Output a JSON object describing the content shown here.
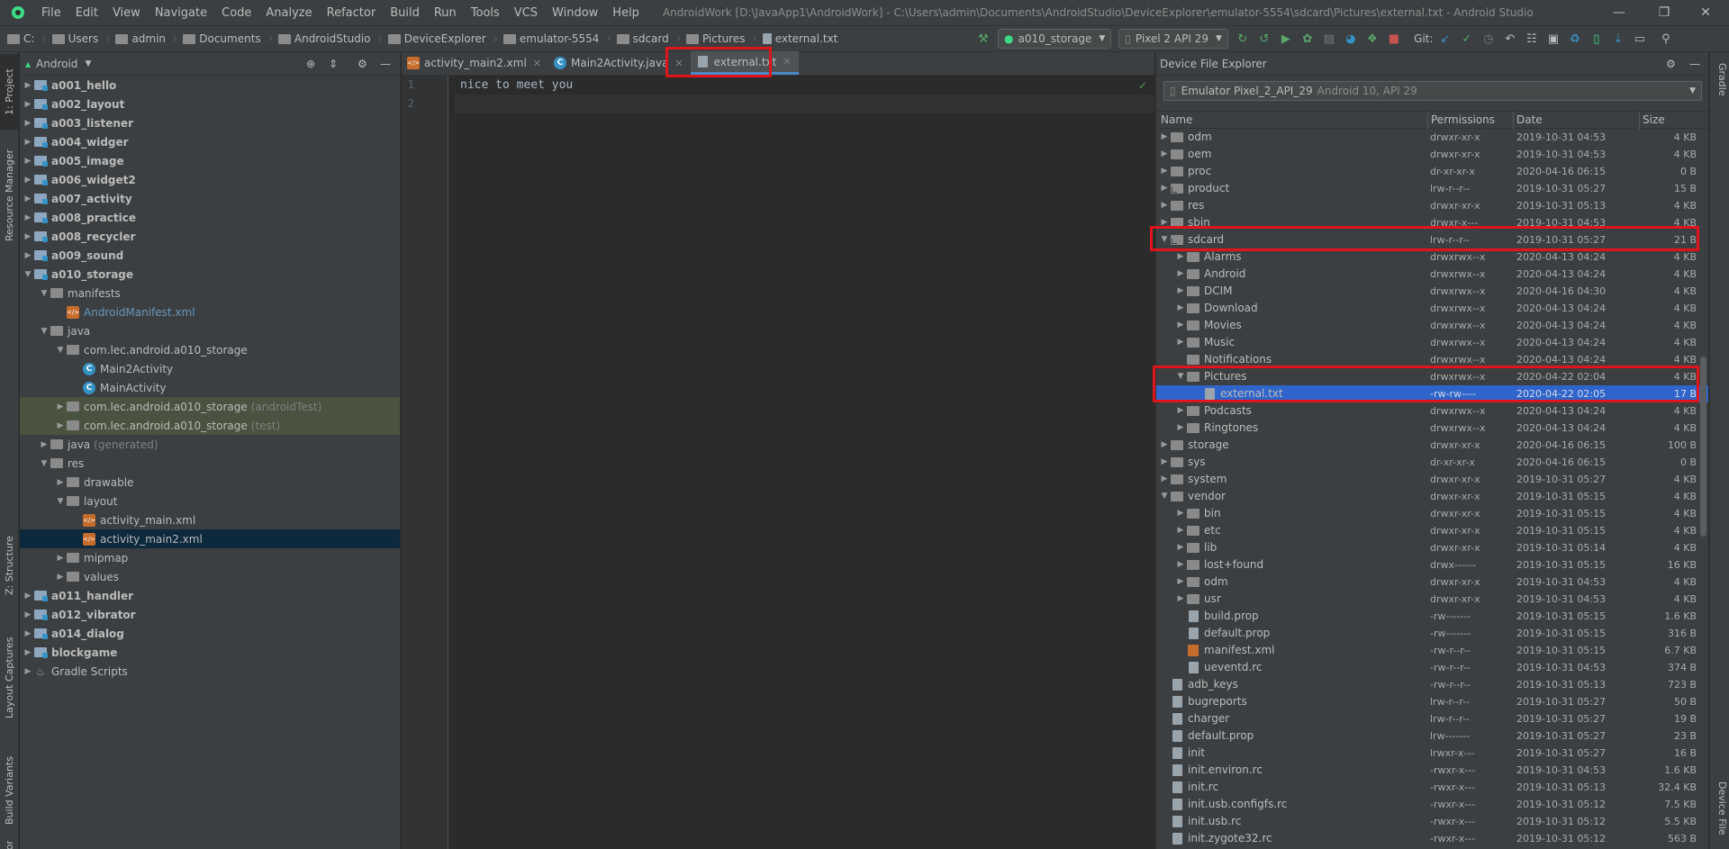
{
  "menubar": {
    "items": [
      "File",
      "Edit",
      "View",
      "Navigate",
      "Code",
      "Analyze",
      "Refactor",
      "Build",
      "Run",
      "Tools",
      "VCS",
      "Window",
      "Help"
    ],
    "window_title": "AndroidWork [D:\\JavaApp1\\AndroidWork] - C:\\Users\\admin\\Documents\\AndroidStudio\\DeviceExplorer\\emulator-5554\\sdcard\\Pictures\\external.txt - Android Studio"
  },
  "breadcrumb": [
    "C:",
    "Users",
    "admin",
    "Documents",
    "AndroidStudio",
    "DeviceExplorer",
    "emulator-5554",
    "sdcard",
    "Pictures",
    "external.txt"
  ],
  "toolbar": {
    "run_config": "a010_storage",
    "device": "Pixel 2 API 29",
    "git_label": "Git:"
  },
  "left_strip": {
    "tabs": [
      "1: Project",
      "Resource Manager",
      "Z: Structure",
      "Layout Captures",
      "Build Variants",
      "Favorites"
    ]
  },
  "right_strip": {
    "tabs": [
      "Gradle",
      "Device File"
    ]
  },
  "project": {
    "view_mode": "Android",
    "tree": [
      {
        "label": "a001_hello",
        "indent": 0,
        "arrow": "▶",
        "icon": "module-folder",
        "bold": true
      },
      {
        "label": "a002_layout",
        "indent": 0,
        "arrow": "▶",
        "icon": "module-folder",
        "bold": true
      },
      {
        "label": "a003_listener",
        "indent": 0,
        "arrow": "▶",
        "icon": "module-folder",
        "bold": true
      },
      {
        "label": "a004_widger",
        "indent": 0,
        "arrow": "▶",
        "icon": "module-folder",
        "bold": true
      },
      {
        "label": "a005_image",
        "indent": 0,
        "arrow": "▶",
        "icon": "module-folder",
        "bold": true
      },
      {
        "label": "a006_widget2",
        "indent": 0,
        "arrow": "▶",
        "icon": "module-folder",
        "bold": true
      },
      {
        "label": "a007_activity",
        "indent": 0,
        "arrow": "▶",
        "icon": "module-folder",
        "bold": true
      },
      {
        "label": "a008_practice",
        "indent": 0,
        "arrow": "▶",
        "icon": "module-folder",
        "bold": true
      },
      {
        "label": "a008_recycler",
        "indent": 0,
        "arrow": "▶",
        "icon": "module-folder",
        "bold": true
      },
      {
        "label": "a009_sound",
        "indent": 0,
        "arrow": "▶",
        "icon": "module-folder",
        "bold": true
      },
      {
        "label": "a010_storage",
        "indent": 0,
        "arrow": "▼",
        "icon": "module-folder",
        "bold": true
      },
      {
        "label": "manifests",
        "indent": 1,
        "arrow": "▼",
        "icon": "folder"
      },
      {
        "label": "AndroidManifest.xml",
        "indent": 2,
        "arrow": "",
        "icon": "xml",
        "color": "#6897bb"
      },
      {
        "label": "java",
        "indent": 1,
        "arrow": "▼",
        "icon": "folder"
      },
      {
        "label": "com.lec.android.a010_storage",
        "indent": 2,
        "arrow": "▼",
        "icon": "folder"
      },
      {
        "label": "Main2Activity",
        "indent": 3,
        "arrow": "",
        "icon": "class"
      },
      {
        "label": "MainActivity",
        "indent": 3,
        "arrow": "",
        "icon": "class"
      },
      {
        "label": "com.lec.android.a010_storage",
        "suffix": "(androidTest)",
        "indent": 2,
        "arrow": "▶",
        "icon": "folder",
        "bg": "#49533f"
      },
      {
        "label": "com.lec.android.a010_storage",
        "suffix": "(test)",
        "indent": 2,
        "arrow": "▶",
        "icon": "folder",
        "bg": "#49533f"
      },
      {
        "label": "java",
        "suffix": "(generated)",
        "indent": 1,
        "arrow": "▶",
        "icon": "folder"
      },
      {
        "label": "res",
        "indent": 1,
        "arrow": "▼",
        "icon": "folder"
      },
      {
        "label": "drawable",
        "indent": 2,
        "arrow": "▶",
        "icon": "folder"
      },
      {
        "label": "layout",
        "indent": 2,
        "arrow": "▼",
        "icon": "folder"
      },
      {
        "label": "activity_main.xml",
        "indent": 3,
        "arrow": "",
        "icon": "xml"
      },
      {
        "label": "activity_main2.xml",
        "indent": 3,
        "arrow": "",
        "icon": "xml",
        "bg": "#0d293e"
      },
      {
        "label": "mipmap",
        "indent": 2,
        "arrow": "▶",
        "icon": "folder"
      },
      {
        "label": "values",
        "indent": 2,
        "arrow": "▶",
        "icon": "folder"
      },
      {
        "label": "a011_handler",
        "indent": 0,
        "arrow": "▶",
        "icon": "module-folder",
        "bold": true
      },
      {
        "label": "a012_vibrator",
        "indent": 0,
        "arrow": "▶",
        "icon": "module-folder",
        "bold": true
      },
      {
        "label": "a014_dialog",
        "indent": 0,
        "arrow": "▶",
        "icon": "module-folder",
        "bold": true
      },
      {
        "label": "blockgame",
        "indent": 0,
        "arrow": "▶",
        "icon": "module-folder",
        "bold": true
      },
      {
        "label": "Gradle Scripts",
        "indent": 0,
        "arrow": "▶",
        "icon": "gradle"
      }
    ]
  },
  "editor": {
    "tabs": [
      {
        "label": "activity_main2.xml",
        "icon": "xml",
        "active": false
      },
      {
        "label": "Main2Activity.java",
        "icon": "class",
        "active": false
      },
      {
        "label": "external.txt",
        "icon": "file",
        "active": true
      }
    ],
    "line_numbers": [
      "1",
      "2"
    ],
    "lines": [
      "nice to meet you",
      ""
    ]
  },
  "device_explorer": {
    "title": "Device File Explorer",
    "device": "Emulator Pixel_2_API_29",
    "device_detail": "Android 10, API 29",
    "columns": [
      "Name",
      "Permissions",
      "Date",
      "Size"
    ],
    "rows": [
      {
        "name": "odm",
        "indent": 0,
        "arrow": "▶",
        "icon": "folder",
        "perm": "drwxr-xr-x",
        "date": "2019-10-31 04:53",
        "size": "4 KB"
      },
      {
        "name": "oem",
        "indent": 0,
        "arrow": "▶",
        "icon": "folder",
        "perm": "drwxr-xr-x",
        "date": "2019-10-31 04:53",
        "size": "4 KB"
      },
      {
        "name": "proc",
        "indent": 0,
        "arrow": "▶",
        "icon": "folder",
        "perm": "dr-xr-xr-x",
        "date": "2020-04-16 06:15",
        "size": "0 B"
      },
      {
        "name": "product",
        "indent": 0,
        "arrow": "▶",
        "icon": "link",
        "perm": "lrw-r--r--",
        "date": "2019-10-31 05:27",
        "size": "15 B"
      },
      {
        "name": "res",
        "indent": 0,
        "arrow": "▶",
        "icon": "folder",
        "perm": "drwxr-xr-x",
        "date": "2019-10-31 05:13",
        "size": "4 KB"
      },
      {
        "name": "sbin",
        "indent": 0,
        "arrow": "▶",
        "icon": "folder",
        "perm": "drwxr-x---",
        "date": "2019-10-31 04:53",
        "size": "4 KB"
      },
      {
        "name": "sdcard",
        "indent": 0,
        "arrow": "▼",
        "icon": "link",
        "perm": "lrw-r--r--",
        "date": "2019-10-31 05:27",
        "size": "21 B"
      },
      {
        "name": "Alarms",
        "indent": 1,
        "arrow": "▶",
        "icon": "folder",
        "perm": "drwxrwx--x",
        "date": "2020-04-13 04:24",
        "size": "4 KB"
      },
      {
        "name": "Android",
        "indent": 1,
        "arrow": "▶",
        "icon": "folder",
        "perm": "drwxrwx--x",
        "date": "2020-04-13 04:24",
        "size": "4 KB"
      },
      {
        "name": "DCIM",
        "indent": 1,
        "arrow": "▶",
        "icon": "folder",
        "perm": "drwxrwx--x",
        "date": "2020-04-16 04:30",
        "size": "4 KB"
      },
      {
        "name": "Download",
        "indent": 1,
        "arrow": "▶",
        "icon": "folder",
        "perm": "drwxrwx--x",
        "date": "2020-04-13 04:24",
        "size": "4 KB"
      },
      {
        "name": "Movies",
        "indent": 1,
        "arrow": "▶",
        "icon": "folder",
        "perm": "drwxrwx--x",
        "date": "2020-04-13 04:24",
        "size": "4 KB"
      },
      {
        "name": "Music",
        "indent": 1,
        "arrow": "▶",
        "icon": "folder",
        "perm": "drwxrwx--x",
        "date": "2020-04-13 04:24",
        "size": "4 KB"
      },
      {
        "name": "Notifications",
        "indent": 1,
        "arrow": "",
        "icon": "folder",
        "perm": "drwxrwx--x",
        "date": "2020-04-13 04:24",
        "size": "4 KB"
      },
      {
        "name": "Pictures",
        "indent": 1,
        "arrow": "▼",
        "icon": "folder",
        "perm": "drwxrwx--x",
        "date": "2020-04-22 02:04",
        "size": "4 KB"
      },
      {
        "name": "external.txt",
        "indent": 2,
        "arrow": "",
        "icon": "file",
        "perm": "-rw-rw----",
        "date": "2020-04-22 02:05",
        "size": "17 B",
        "selected": true
      },
      {
        "name": "Podcasts",
        "indent": 1,
        "arrow": "▶",
        "icon": "folder",
        "perm": "drwxrwx--x",
        "date": "2020-04-13 04:24",
        "size": "4 KB"
      },
      {
        "name": "Ringtones",
        "indent": 1,
        "arrow": "▶",
        "icon": "folder",
        "perm": "drwxrwx--x",
        "date": "2020-04-13 04:24",
        "size": "4 KB"
      },
      {
        "name": "storage",
        "indent": 0,
        "arrow": "▶",
        "icon": "folder",
        "perm": "drwxr-xr-x",
        "date": "2020-04-16 06:15",
        "size": "100 B"
      },
      {
        "name": "sys",
        "indent": 0,
        "arrow": "▶",
        "icon": "folder",
        "perm": "dr-xr-xr-x",
        "date": "2020-04-16 06:15",
        "size": "0 B"
      },
      {
        "name": "system",
        "indent": 0,
        "arrow": "▶",
        "icon": "folder",
        "perm": "drwxr-xr-x",
        "date": "2019-10-31 05:27",
        "size": "4 KB"
      },
      {
        "name": "vendor",
        "indent": 0,
        "arrow": "▼",
        "icon": "folder",
        "perm": "drwxr-xr-x",
        "date": "2019-10-31 05:15",
        "size": "4 KB"
      },
      {
        "name": "bin",
        "indent": 1,
        "arrow": "▶",
        "icon": "folder",
        "perm": "drwxr-xr-x",
        "date": "2019-10-31 05:15",
        "size": "4 KB"
      },
      {
        "name": "etc",
        "indent": 1,
        "arrow": "▶",
        "icon": "folder",
        "perm": "drwxr-xr-x",
        "date": "2019-10-31 05:15",
        "size": "4 KB"
      },
      {
        "name": "lib",
        "indent": 1,
        "arrow": "▶",
        "icon": "folder",
        "perm": "drwxr-xr-x",
        "date": "2019-10-31 05:14",
        "size": "4 KB"
      },
      {
        "name": "lost+found",
        "indent": 1,
        "arrow": "▶",
        "icon": "folder",
        "perm": "drwx------",
        "date": "2019-10-31 05:15",
        "size": "16 KB"
      },
      {
        "name": "odm",
        "indent": 1,
        "arrow": "▶",
        "icon": "folder",
        "perm": "drwxr-xr-x",
        "date": "2019-10-31 04:53",
        "size": "4 KB"
      },
      {
        "name": "usr",
        "indent": 1,
        "arrow": "▶",
        "icon": "folder",
        "perm": "drwxr-xr-x",
        "date": "2019-10-31 04:53",
        "size": "4 KB"
      },
      {
        "name": "build.prop",
        "indent": 1,
        "arrow": "",
        "icon": "file",
        "perm": "-rw-------",
        "date": "2019-10-31 05:15",
        "size": "1.6 KB"
      },
      {
        "name": "default.prop",
        "indent": 1,
        "arrow": "",
        "icon": "file",
        "perm": "-rw-------",
        "date": "2019-10-31 05:15",
        "size": "316 B"
      },
      {
        "name": "manifest.xml",
        "indent": 1,
        "arrow": "",
        "icon": "xml",
        "perm": "-rw-r--r--",
        "date": "2019-10-31 05:15",
        "size": "6.7 KB"
      },
      {
        "name": "ueventd.rc",
        "indent": 1,
        "arrow": "",
        "icon": "file",
        "perm": "-rw-r--r--",
        "date": "2019-10-31 04:53",
        "size": "374 B"
      },
      {
        "name": "adb_keys",
        "indent": 0,
        "arrow": "",
        "icon": "file",
        "perm": "-rw-r--r--",
        "date": "2019-10-31 05:13",
        "size": "723 B"
      },
      {
        "name": "bugreports",
        "indent": 0,
        "arrow": "",
        "icon": "file",
        "perm": "lrw-r--r--",
        "date": "2019-10-31 05:27",
        "size": "50 B"
      },
      {
        "name": "charger",
        "indent": 0,
        "arrow": "",
        "icon": "file",
        "perm": "lrw-r--r--",
        "date": "2019-10-31 05:27",
        "size": "19 B"
      },
      {
        "name": "default.prop",
        "indent": 0,
        "arrow": "",
        "icon": "file",
        "perm": "lrw-------",
        "date": "2019-10-31 05:27",
        "size": "23 B"
      },
      {
        "name": "init",
        "indent": 0,
        "arrow": "",
        "icon": "file",
        "perm": "lrwxr-x---",
        "date": "2019-10-31 05:27",
        "size": "16 B"
      },
      {
        "name": "init.environ.rc",
        "indent": 0,
        "arrow": "",
        "icon": "file",
        "perm": "-rwxr-x---",
        "date": "2019-10-31 04:53",
        "size": "1.6 KB"
      },
      {
        "name": "init.rc",
        "indent": 0,
        "arrow": "",
        "icon": "file",
        "perm": "-rwxr-x---",
        "date": "2019-10-31 05:13",
        "size": "32.4 KB"
      },
      {
        "name": "init.usb.configfs.rc",
        "indent": 0,
        "arrow": "",
        "icon": "file",
        "perm": "-rwxr-x---",
        "date": "2019-10-31 05:12",
        "size": "7.5 KB"
      },
      {
        "name": "init.usb.rc",
        "indent": 0,
        "arrow": "",
        "icon": "file",
        "perm": "-rwxr-x---",
        "date": "2019-10-31 05:12",
        "size": "5.5 KB"
      },
      {
        "name": "init.zygote32.rc",
        "indent": 0,
        "arrow": "",
        "icon": "file",
        "perm": "-rwxr-x---",
        "date": "2019-10-31 05:12",
        "size": "563 B"
      }
    ]
  },
  "colors": {
    "accent": "#4a88c7",
    "highlight_box": "#e0151c",
    "selection": "#2f65ca"
  }
}
